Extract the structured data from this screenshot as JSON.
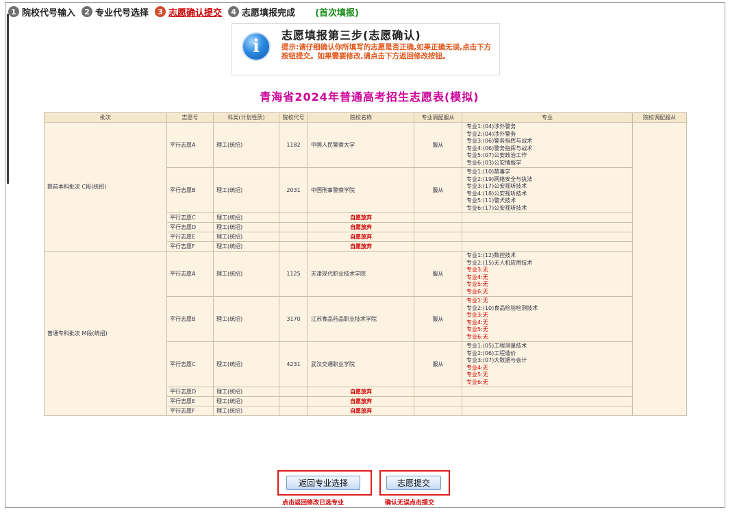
{
  "steps": [
    {
      "num": "1",
      "label": "院校代号输入",
      "active": false
    },
    {
      "num": "2",
      "label": "专业代号选择",
      "active": false
    },
    {
      "num": "3",
      "label": "志愿确认提交",
      "active": true
    },
    {
      "num": "4",
      "label": "志愿填报完成",
      "active": false
    }
  ],
  "first_fill": "(首次填报)",
  "info": {
    "title": "志愿填报第三步(志愿确认)",
    "text": "提示:请仔细确认你所填写的志愿是否正确,如果正确无误,点击下方按钮提交。如果需要修改,请点击下方返回修改按钮。"
  },
  "main_title": "青海省2024年普通高考招生志愿表(模拟)",
  "table": {
    "headers": [
      "批次",
      "志愿号",
      "科类(计划性质)",
      "院校代号",
      "院校名称",
      "专业调配服从",
      "专业",
      "院校调配服从"
    ],
    "given_up": "自愿放弃",
    "groups": [
      {
        "batch": "提前本科批次 C段(统招)",
        "rows": [
          {
            "vol": "平行志愿A",
            "cat": "理工(统招)",
            "code": "1182",
            "school": "中国人民警察大学",
            "adjust": "服从",
            "majors": [
              "专业1:(04)涉外警务",
              "专业2:(04)涉外警务",
              "专业3:(06)警务指挥与战术",
              "专业4:(06)警务指挥与战术",
              "专业5:(07)公安政治工作",
              "专业6:(03)公安情报学"
            ]
          },
          {
            "vol": "平行志愿B",
            "cat": "理工(统招)",
            "code": "2031",
            "school": "中国刑事警察学院",
            "adjust": "服从",
            "majors": [
              "专业1:(10)禁毒学",
              "专业2:(19)网络安全与执法",
              "专业3:(17)公安视听技术",
              "专业4:(18)公安视听技术",
              "专业5:(11)警犬技术",
              "专业6:(17)公安视听技术"
            ]
          },
          {
            "vol": "平行志愿C",
            "cat": "理工(统招)",
            "given_up": true
          },
          {
            "vol": "平行志愿D",
            "cat": "理工(统招)",
            "given_up": true
          },
          {
            "vol": "平行志愿E",
            "cat": "理工(统招)",
            "given_up": true
          },
          {
            "vol": "平行志愿F",
            "cat": "理工(统招)",
            "given_up": true
          }
        ]
      },
      {
        "batch": "普通专科批次 M段(统招)",
        "rows": [
          {
            "vol": "平行志愿A",
            "cat": "理工(统招)",
            "code": "1125",
            "school": "天津现代职业技术学院",
            "adjust": "服从",
            "majors": [
              "专业1:(12)数控技术",
              "专业2:(15)无人机应用技术",
              "专业3:无",
              "专业4:无",
              "专业5:无",
              "专业6:无"
            ]
          },
          {
            "vol": "平行志愿B",
            "cat": "理工(统招)",
            "code": "3170",
            "school": "江苏食品药品职业技术学院",
            "adjust": "服从",
            "majors": [
              "专业1:无",
              "专业2:(10)食品检验检测技术",
              "专业3:无",
              "专业4:无",
              "专业5:无",
              "专业6:无"
            ]
          },
          {
            "vol": "平行志愿C",
            "cat": "理工(统招)",
            "code": "4231",
            "school": "武汉交通职业学院",
            "adjust": "服从",
            "majors": [
              "专业1:(05)工程测量技术",
              "专业2:(06)工程造价",
              "专业3:(07)大数据与会计",
              "专业4:无",
              "专业5:无",
              "专业6:无"
            ]
          },
          {
            "vol": "平行志愿D",
            "cat": "理工(统招)",
            "given_up": true
          },
          {
            "vol": "平行志愿E",
            "cat": "理工(统招)",
            "given_up": true
          },
          {
            "vol": "平行志愿F",
            "cat": "理工(统招)",
            "given_up": true
          }
        ]
      }
    ]
  },
  "buttons": {
    "back_label": "返回专业选择",
    "back_hint": "点击返回修改已选专业",
    "submit_label": "志愿提交",
    "submit_hint": "确认无误点击提交"
  },
  "colors": {
    "accent_red": "#d00000",
    "title_magenta": "#cc0099",
    "table_bg": "#fcf3e2"
  }
}
